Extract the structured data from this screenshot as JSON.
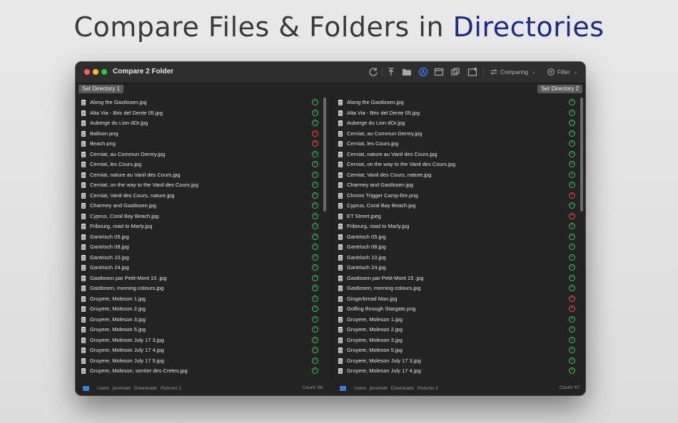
{
  "headline": {
    "part1": "Compare Files & Folders in ",
    "part2": "Directories"
  },
  "window": {
    "title": "Compare 2 Folder"
  },
  "toolbar": {
    "comparing_label": "Comparing",
    "filter_label": "Filter"
  },
  "left": {
    "set_dir_label": "Set Directory 1",
    "files": [
      {
        "name": "Along the Gastlosen.jpg",
        "status": "ok"
      },
      {
        "name": "Alta Via - Bric del Dente 05.jpg",
        "status": "ok"
      },
      {
        "name": "Auberge du Lion dOr.jpg",
        "status": "ok"
      },
      {
        "name": "Balloon.png",
        "status": "bad"
      },
      {
        "name": "Beach.png",
        "status": "bad"
      },
      {
        "name": "Cerniat, au Commun Derrey.jpg",
        "status": "ok"
      },
      {
        "name": "Cerniat, les Cours.jpg",
        "status": "ok"
      },
      {
        "name": "Cerniat, nature au Vanil des Cours.jpg",
        "status": "ok"
      },
      {
        "name": "Cerniat, on the way to the Vanil des Cours.jpg",
        "status": "ok"
      },
      {
        "name": "Cerniat, Vanil des Cours, nature.jpg",
        "status": "ok"
      },
      {
        "name": "Charmey and Gastlosen.jpg",
        "status": "ok"
      },
      {
        "name": "Cyprus, Coral Bay Beach.jpg",
        "status": "ok"
      },
      {
        "name": "Fribourg, road to Marly.jpg",
        "status": "ok"
      },
      {
        "name": "Gantrisch 05.jpg",
        "status": "ok"
      },
      {
        "name": "Gantrisch 08.jpg",
        "status": "ok"
      },
      {
        "name": "Gantrisch 10.jpg",
        "status": "ok"
      },
      {
        "name": "Gantrisch 24.jpg",
        "status": "ok"
      },
      {
        "name": "Gastlosen par Petit-Mont 15 .jpg",
        "status": "ok"
      },
      {
        "name": "Gastlosen, morning colours.jpg",
        "status": "ok"
      },
      {
        "name": "Gruyere, Moleson 1.jpg",
        "status": "ok"
      },
      {
        "name": "Gruyere, Moleson 2.jpg",
        "status": "ok"
      },
      {
        "name": "Gruyere, Moleson 3.jpg",
        "status": "ok"
      },
      {
        "name": "Gruyere, Moleson 5.jpg",
        "status": "ok"
      },
      {
        "name": "Gruyere, Moleson July 17 3.jpg",
        "status": "ok"
      },
      {
        "name": "Gruyere, Moleson July 17 4.jpg",
        "status": "ok"
      },
      {
        "name": "Gruyere, Moleson July 17 5.jpg",
        "status": "ok"
      },
      {
        "name": "Gruyere, Moleson, sentier des Cretes.jpg",
        "status": "ok"
      }
    ],
    "path": [
      "Users",
      "jeremiah",
      "Downloads",
      "Pictures 1"
    ],
    "count": "Count: 66"
  },
  "right": {
    "set_dir_label": "Set Directory 2",
    "files": [
      {
        "name": "Along the Gastlosen.jpg",
        "status": "ok"
      },
      {
        "name": "Alta Via - Bric del Dente 05.jpg",
        "status": "ok"
      },
      {
        "name": "Auberge du Lion dOr.jpg",
        "status": "ok"
      },
      {
        "name": "Cerniat, au Commun Derrey.jpg",
        "status": "ok"
      },
      {
        "name": "Cerniat, les Cours.jpg",
        "status": "ok"
      },
      {
        "name": "Cerniat, nature au Vanil des Cours.jpg",
        "status": "ok"
      },
      {
        "name": "Cerniat, on the way to the Vanil des Cours.jpg",
        "status": "ok"
      },
      {
        "name": "Cerniat, Vanil des Cours, nature.jpg",
        "status": "ok"
      },
      {
        "name": "Charmey and Gastlosen.jpg",
        "status": "ok"
      },
      {
        "name": "Chrono Trigger Camp-fire.png",
        "status": "bad"
      },
      {
        "name": "Cyprus, Coral Bay Beach.jpg",
        "status": "ok"
      },
      {
        "name": "ET Street.jpeg",
        "status": "bad"
      },
      {
        "name": "Fribourg, road to Marly.jpg",
        "status": "ok"
      },
      {
        "name": "Gantrisch 05.jpg",
        "status": "ok"
      },
      {
        "name": "Gantrisch 08.jpg",
        "status": "ok"
      },
      {
        "name": "Gantrisch 10.jpg",
        "status": "ok"
      },
      {
        "name": "Gantrisch 24.jpg",
        "status": "ok"
      },
      {
        "name": "Gastlosen par Petit-Mont 15 .jpg",
        "status": "ok"
      },
      {
        "name": "Gastlosen, morning colours.jpg",
        "status": "ok"
      },
      {
        "name": "Gingerbread Man.jpg",
        "status": "bad"
      },
      {
        "name": "Golfing through Stargate.png",
        "status": "bad"
      },
      {
        "name": "Gruyere, Moleson 1.jpg",
        "status": "ok"
      },
      {
        "name": "Gruyere, Moleson 2.jpg",
        "status": "ok"
      },
      {
        "name": "Gruyere, Moleson 3.jpg",
        "status": "ok"
      },
      {
        "name": "Gruyere, Moleson 5.jpg",
        "status": "ok"
      },
      {
        "name": "Gruyere, Moleson July 17 3.jpg",
        "status": "ok"
      },
      {
        "name": "Gruyere, Moleson July 17 4.jpg",
        "status": "ok"
      }
    ],
    "path": [
      "Users",
      "jeremiah",
      "Downloads",
      "Pictures 2"
    ],
    "count": "Count: 67"
  },
  "colors": {
    "ok": "#34c759",
    "bad": "#ff453a",
    "accent": "#1d2a8a"
  }
}
